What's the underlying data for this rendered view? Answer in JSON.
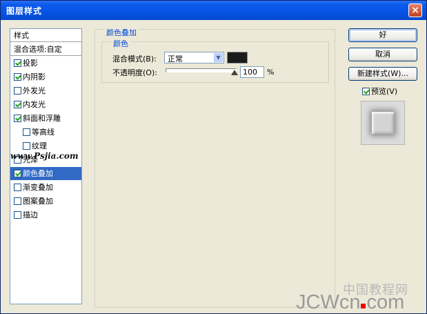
{
  "window": {
    "title": "图层样式",
    "close": "×"
  },
  "styles_list": {
    "header": "样式",
    "blend_options": "混合选项:自定",
    "items": [
      {
        "label": "投影",
        "checked": true
      },
      {
        "label": "内阴影",
        "checked": true
      },
      {
        "label": "外发光",
        "checked": false
      },
      {
        "label": "内发光",
        "checked": true
      },
      {
        "label": "斜面和浮雕",
        "checked": true
      },
      {
        "label": "等高线",
        "checked": false
      },
      {
        "label": "纹理",
        "checked": false
      },
      {
        "label": "光泽",
        "checked": false
      },
      {
        "label": "颜色叠加",
        "checked": true,
        "selected": true
      },
      {
        "label": "渐变叠加",
        "checked": false
      },
      {
        "label": "图案叠加",
        "checked": false
      },
      {
        "label": "描边",
        "checked": false
      }
    ]
  },
  "color_overlay": {
    "section_title": "颜色叠加",
    "group_title": "颜色",
    "blend_mode_label": "混合模式(B):",
    "blend_mode_value": "正常",
    "color": "#1b1b1b",
    "opacity_label": "不透明度(O):",
    "opacity_value": "100",
    "opacity_unit": "%"
  },
  "buttons": {
    "ok": "好",
    "cancel": "取消",
    "new_style": "新建样式(W)..."
  },
  "preview": {
    "label": "预览(V)",
    "checked": true
  },
  "watermarks": {
    "site1": "www.Psjia.com",
    "site2_cn": "中国教程网",
    "site2_en_a": "JCWcn",
    "site2_en_b": "com"
  }
}
